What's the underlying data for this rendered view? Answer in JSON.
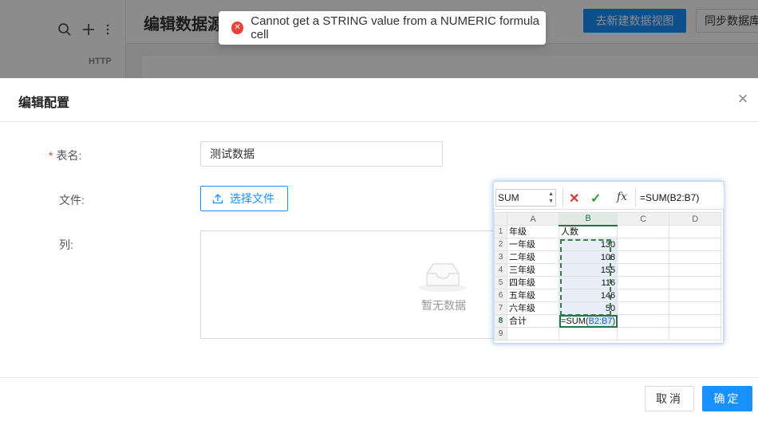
{
  "background": {
    "page_title": "编辑数据源",
    "section_label": "HTTP",
    "new_view_button": "去新建数据视图",
    "sync_button": "同步数据库"
  },
  "toast": {
    "message": "Cannot get a STRING value from a NUMERIC formula cell",
    "icon": "error-icon"
  },
  "modal": {
    "title": "编辑配置",
    "close_symbol": "×",
    "form": {
      "table_name_label": "表名:",
      "table_name_value": "测试数据",
      "file_label": "文件:",
      "upload_button": "选择文件",
      "columns_label": "列:",
      "empty_text": "暂无数据"
    },
    "footer": {
      "cancel": "取消",
      "ok": "确定"
    }
  },
  "spreadsheet": {
    "name_box": "SUM",
    "formula": "=SUM(B2:B7)",
    "columns": [
      "A",
      "B",
      "C",
      "D"
    ],
    "rows": [
      {
        "n": "1",
        "a": "年级",
        "b": "人数"
      },
      {
        "n": "2",
        "a": "一年级",
        "b": "130"
      },
      {
        "n": "3",
        "a": "二年级",
        "b": "108"
      },
      {
        "n": "4",
        "a": "三年级",
        "b": "155"
      },
      {
        "n": "5",
        "a": "四年级",
        "b": "116"
      },
      {
        "n": "6",
        "a": "五年级",
        "b": "146"
      },
      {
        "n": "7",
        "a": "六年级",
        "b": "50"
      },
      {
        "n": "8",
        "a": "合计",
        "b_prefix": "=SUM(",
        "b_ref": "B2:B7",
        "b_suffix": ")"
      },
      {
        "n": "9",
        "a": "",
        "b": ""
      }
    ]
  },
  "colors": {
    "primary": "#1890ff",
    "error": "#e8433a",
    "excel_green": "#217346"
  }
}
